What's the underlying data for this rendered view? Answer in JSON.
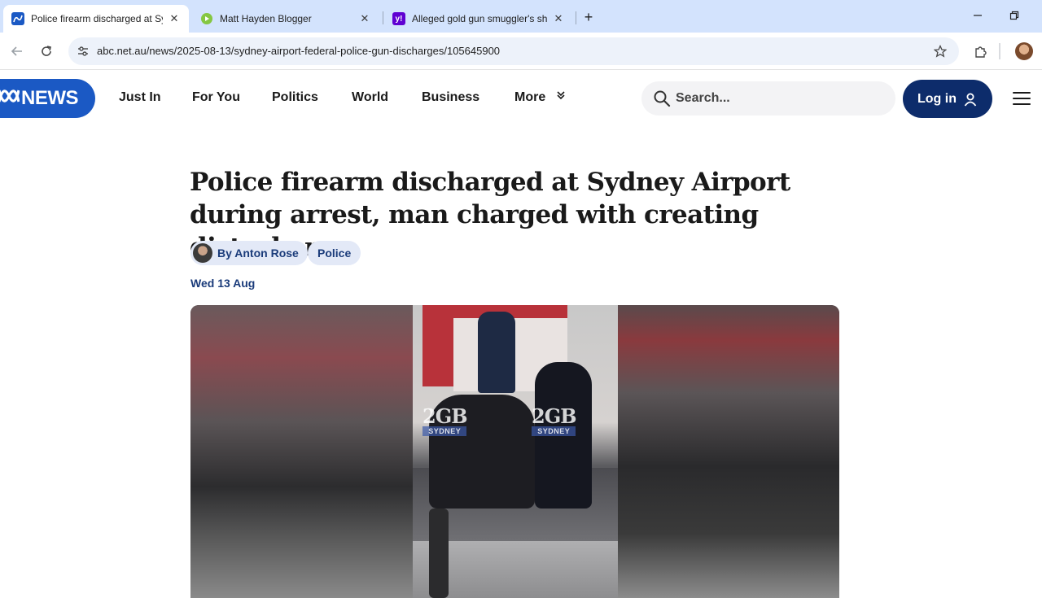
{
  "browser": {
    "tabs": [
      {
        "title": "Police firearm discharged at Syd",
        "favicon": "abc-favicon-icon",
        "active": true
      },
      {
        "title": "Matt Hayden Blogger",
        "favicon": "rumble-favicon-icon",
        "active": false
      },
      {
        "title": "Alleged gold gun smuggler's sh",
        "favicon": "yahoo-favicon-icon",
        "active": false
      }
    ],
    "url": "abc.net.au/news/2025-08-13/sydney-airport-federal-police-gun-discharges/105645900"
  },
  "site": {
    "logo_text": "NEWS",
    "nav": [
      "Just In",
      "For You",
      "Politics",
      "World",
      "Business",
      "More"
    ],
    "search_placeholder": "Search...",
    "login_label": "Log in"
  },
  "article": {
    "headline": "Police firearm discharged at Sydney Airport during arrest, man charged with creating disturbance",
    "author": "By Anton Rose",
    "topic": "Police",
    "date": "Wed 13 Aug",
    "media_watermark": {
      "brand": "2GB",
      "city": "SYDNEY"
    }
  },
  "colors": {
    "tabstrip": "#d3e3fd",
    "abc_blue": "#1b59c4",
    "login_navy": "#0d2c6b",
    "chip_bg": "#e3e9f7",
    "chip_text": "#1a3b7a"
  }
}
